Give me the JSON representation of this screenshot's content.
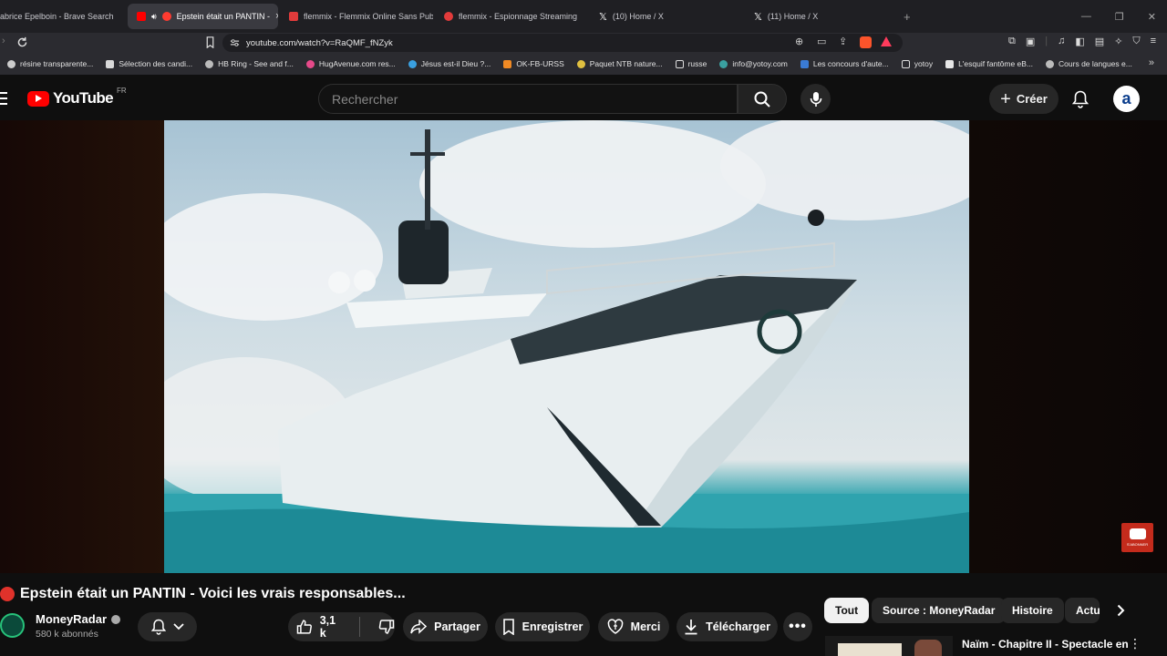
{
  "browser": {
    "tabs": [
      {
        "label": "abrice Epelboin - Brave Search",
        "color": "#f0562f"
      },
      {
        "label": "Epstein était un PANTIN -",
        "color": "#ff0000"
      },
      {
        "label": "flemmix - Flemmix Online Sans Publi",
        "color": "#e23b3b"
      },
      {
        "label": "flemmix - Espionnage Streaming",
        "color": "#e23b3b"
      },
      {
        "label": "(10) Home / X",
        "color": "#ffffff"
      },
      {
        "label": "(11) Home / X",
        "color": "#ffffff"
      }
    ],
    "url": "youtube.com/watch?v=RaQMF_fNZyk",
    "bookmarks": [
      {
        "label": "résine transparente...",
        "color": "#cccccc"
      },
      {
        "label": "Sélection des candi...",
        "color": "#d8d8d8"
      },
      {
        "label": "HB Ring - See and f...",
        "color": "#bbbbbb"
      },
      {
        "label": "HugAvenue.com res...",
        "color": "#e64a8a"
      },
      {
        "label": "Jésus est-il Dieu ?...",
        "color": "#3aa0e0"
      },
      {
        "label": "OK-FB-URSS",
        "color": "#f08a24"
      },
      {
        "label": "Paquet NTB nature...",
        "color": "#e0c040"
      },
      {
        "label": "russe",
        "color": "#2b2b30"
      },
      {
        "label": "info@yotoy.com",
        "color": "#3aa0a0"
      },
      {
        "label": "Les concours d'aute...",
        "color": "#3a7bd5"
      },
      {
        "label": "yotoy",
        "color": "#2b2b30"
      },
      {
        "label": "L'esquif fantôme eB...",
        "color": "#e6e6e6"
      },
      {
        "label": "Cours de langues e...",
        "color": "#bbbbbb"
      }
    ]
  },
  "youtube": {
    "logo_text": "YouTube",
    "country": "FR",
    "search_placeholder": "Rechercher",
    "create_label": "Créer",
    "avatar_letter": "a"
  },
  "video": {
    "title": "Epstein était un PANTIN - Voici les vrais responsables...",
    "watermark_label": "S'ABONNER",
    "channel_name": "MoneyRadar",
    "subscribers": "580 k abonnés",
    "like_count": "3,1 k",
    "actions": {
      "share": "Partager",
      "save": "Enregistrer",
      "thanks": "Merci",
      "download": "Télécharger"
    }
  },
  "filters": [
    "Tout",
    "Source : MoneyRadar",
    "Histoire",
    "Actu"
  ],
  "recommendation": {
    "title": "Naïm - Chapitre II - Spectacle en"
  },
  "colors": {
    "yt_red": "#ff0000",
    "bg": "#0f0f0f",
    "chip_bg": "#272727"
  }
}
